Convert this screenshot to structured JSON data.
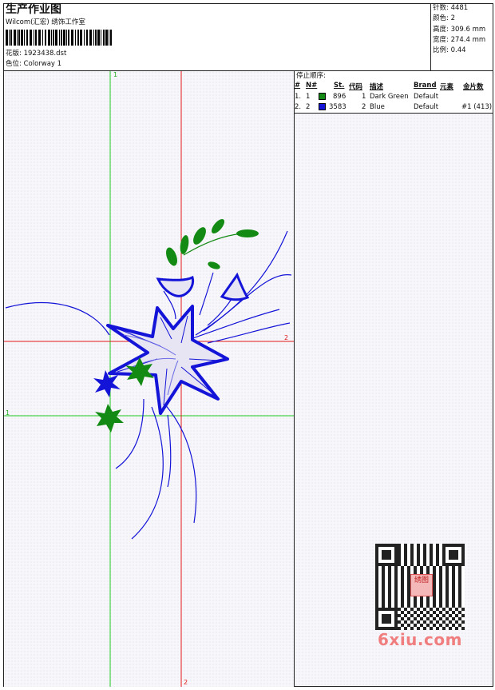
{
  "header": {
    "title": "生产作业图",
    "company": "Wilcom(汇宏) 绣饰工作室",
    "design_label": "花版:",
    "design_value": "1923438.dst",
    "colorway_label": "色位:",
    "colorway_value": "Colorway 1"
  },
  "stats": [
    {
      "label": "针数:",
      "value": "4481"
    },
    {
      "label": "颜色:",
      "value": "2"
    },
    {
      "label": "高度:",
      "value": "309.6 mm"
    },
    {
      "label": "宽度:",
      "value": "274.4 mm"
    },
    {
      "label": "比例:",
      "value": "0.44"
    }
  ],
  "stop_sequence": {
    "title": "停止顺序:",
    "columns": [
      "#",
      "N#",
      "St.",
      "代码",
      "描述",
      "Brand",
      "元素",
      "金片数"
    ],
    "rows": [
      {
        "num": "1.",
        "n": "1",
        "color": "#138a13",
        "stitches": "896",
        "code": "1",
        "description": "Dark Green",
        "brand": "Default",
        "element": "",
        "sequins": ""
      },
      {
        "num": "2.",
        "n": "2",
        "color": "#1414d8",
        "stitches": "3583",
        "code": "2",
        "description": "Blue",
        "brand": "Default",
        "element": "",
        "sequins": "#1 (413)"
      }
    ]
  },
  "canvas": {
    "axis_labels": {
      "green_vertical": "1",
      "green_horizontal": "1",
      "red_horizontal": "2",
      "red_vertical": "2"
    },
    "colors": {
      "green_line": "#22cc22",
      "red_line": "#e01818",
      "blue_thread": "#1414d8",
      "green_thread": "#138a13"
    }
  },
  "watermark": {
    "text": "6xiu.com",
    "logo_text": "绣图"
  }
}
